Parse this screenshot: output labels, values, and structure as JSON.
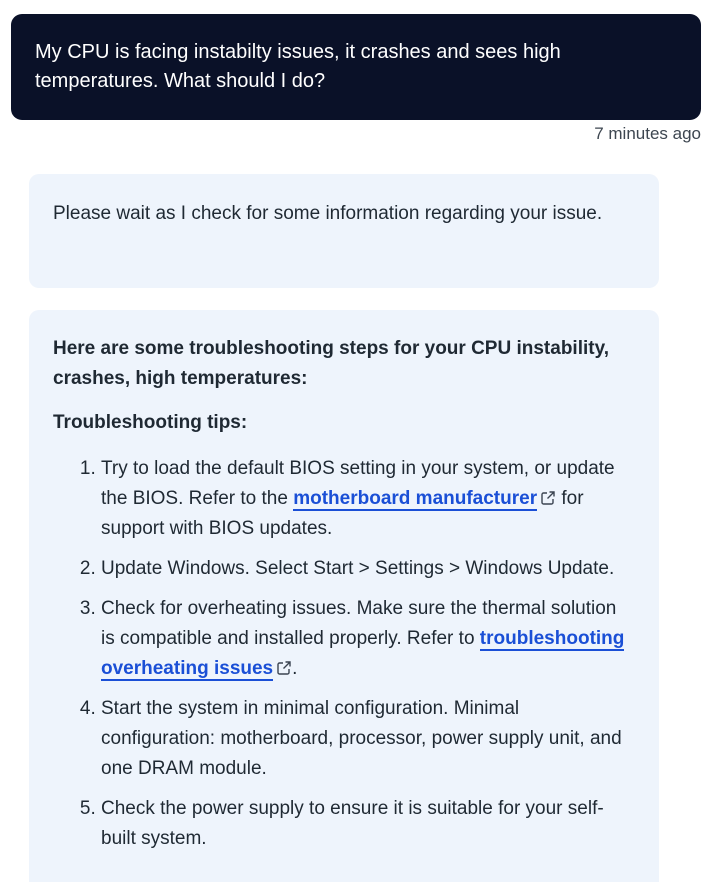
{
  "user_message": {
    "text": "My CPU is facing instabilty issues, it crashes and sees high temperatures. What should I do?",
    "timestamp": "7 minutes ago"
  },
  "bot_messages": {
    "wait": {
      "text": "Please wait as I check for some information regarding your issue."
    },
    "answer": {
      "heading": "Here are some troubleshooting steps for your CPU instability, crashes, high temperatures:",
      "subheading": "Troubleshooting tips:",
      "tips": [
        {
          "before": "Try to load the default BIOS setting in your system, or update the BIOS. Refer to the ",
          "link": "motherboard manufacturer",
          "after": " for support with BIOS updates."
        },
        {
          "text": "Update Windows. Select Start > Settings > Windows Update."
        },
        {
          "before": "Check for overheating issues. Make sure the thermal solution is compatible and installed properly. Refer to ",
          "link": "troubleshooting overheating issues",
          "after": "."
        },
        {
          "text": "Start the system in minimal configuration. Minimal configuration: motherboard, processor, power supply unit, and one DRAM module."
        },
        {
          "text": "Check the power supply to ensure it is suitable for your self-built system."
        }
      ]
    }
  },
  "colors": {
    "user_bubble": "#0a1128",
    "bot_bubble": "#eef4fc",
    "link": "#1a4fd6"
  },
  "icons": {
    "external_link": "external-link-icon"
  }
}
